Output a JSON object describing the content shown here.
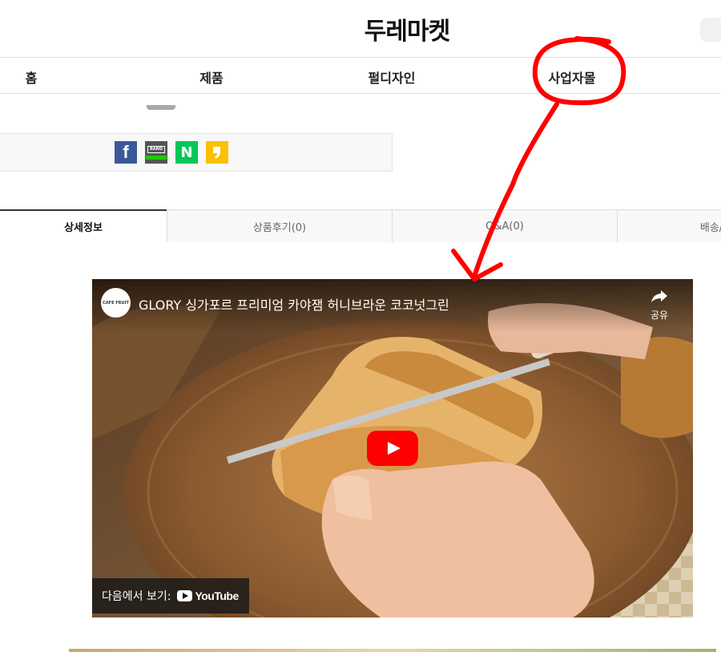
{
  "header": {
    "logo": "두레마켓"
  },
  "nav": {
    "items": [
      {
        "label": "홈"
      },
      {
        "label": "제품"
      },
      {
        "label": "펄디자인"
      },
      {
        "label": "사업자몰"
      }
    ]
  },
  "share": {
    "icons": [
      "facebook-icon",
      "band-icon",
      "naver-icon",
      "kakao-story-icon"
    ],
    "band_label": "BAND",
    "naver_label": "N",
    "facebook_label": "f"
  },
  "tabs": [
    {
      "label": "상세정보",
      "active": true
    },
    {
      "label": "상품후기(0)",
      "active": false
    },
    {
      "label": "Q&A(0)",
      "active": false
    },
    {
      "label": "배송/교환",
      "active": false
    }
  ],
  "video": {
    "channel": "CAFE FRUIT",
    "title": "GLORY 싱가포르 프리미엄 카야잼 허니브라운 코코넛그린",
    "share_label": "공유",
    "watch_on": "다음에서 보기:",
    "youtube_label": "YouTube"
  },
  "colors": {
    "annotation": "#ff0000",
    "facebook": "#3b5998",
    "naver": "#03c75a",
    "kakao": "#fbc000",
    "youtube": "#ff0000"
  }
}
